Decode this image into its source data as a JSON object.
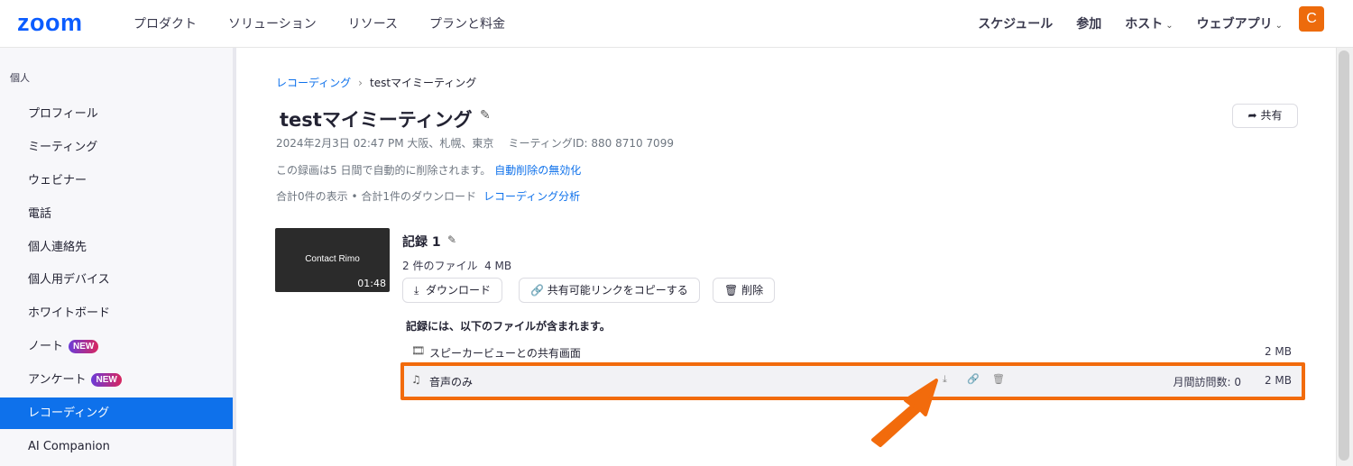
{
  "nav": {
    "logo": "zoom",
    "left": [
      "プロダクト",
      "ソリューション",
      "リソース",
      "プランと料金"
    ],
    "right": [
      {
        "label": "スケジュール",
        "chevron": false
      },
      {
        "label": "参加",
        "chevron": false
      },
      {
        "label": "ホスト",
        "chevron": true
      },
      {
        "label": "ウェブアプリ",
        "chevron": true
      }
    ],
    "avatar": "C",
    "avatar_color": "#ed6b0c"
  },
  "sidebar": {
    "heading": "個人",
    "items": [
      {
        "label": "プロフィール",
        "badge": "",
        "active": false
      },
      {
        "label": "ミーティング",
        "badge": "",
        "active": false
      },
      {
        "label": "ウェビナー",
        "badge": "",
        "active": false
      },
      {
        "label": "電話",
        "badge": "",
        "active": false
      },
      {
        "label": "個人連絡先",
        "badge": "",
        "active": false
      },
      {
        "label": "個人用デバイス",
        "badge": "",
        "active": false
      },
      {
        "label": "ホワイトボード",
        "badge": "",
        "active": false
      },
      {
        "label": "ノート",
        "badge": "NEW",
        "active": false
      },
      {
        "label": "アンケート",
        "badge": "NEW",
        "active": false
      },
      {
        "label": "レコーディング",
        "badge": "",
        "active": true
      },
      {
        "label": "AI Companion",
        "badge": "",
        "active": false
      }
    ],
    "active_color": "#0e71eb"
  },
  "main": {
    "breadcrumb": {
      "parent": "レコーディング",
      "separator": "›",
      "current": "testマイミーティング"
    },
    "title": "testマイミーティング",
    "share_label": "共有",
    "meta": {
      "datetime": "2024年2月3日 02:47 PM 大阪、札幌、東京",
      "meeting_id": "ミーティングID: 880 8710 7099"
    },
    "autodelete": {
      "text": "この録画は5 日間で自動的に削除されます。",
      "link": "自動削除の無効化"
    },
    "summary": {
      "text": "合計0件の表示 • 合計1件のダウンロード",
      "link": "レコーディング分析"
    },
    "recording": {
      "thumb_caption": "Contact Rimo",
      "duration": "01:48",
      "title": "記録 1",
      "files_info": "2 件のファイル  4 MB",
      "buttons": {
        "download": "ダウンロード",
        "copy_link": "共有可能リンクをコピーする",
        "delete": "削除"
      },
      "contains_label": "記録には、以下のファイルが含まれます。",
      "files": [
        {
          "icon": "film-icon",
          "name": "スピーカービューとの共有画面",
          "visits": "",
          "size": "2 MB"
        },
        {
          "icon": "music-note-icon",
          "name": "音声のみ",
          "visits": "月間訪問数: 0",
          "size": "2 MB"
        }
      ]
    }
  },
  "annotation": {
    "highlight_color": "#f26b0c"
  }
}
